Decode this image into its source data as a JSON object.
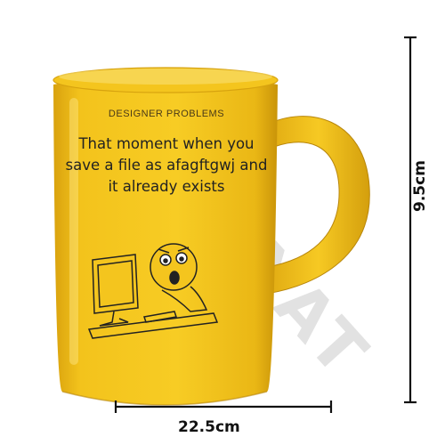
{
  "product": {
    "watermark": "ZEMAYAT",
    "mug": {
      "color": "#f2c21b",
      "label": "DESIGNER PROBLEMS",
      "text_lines": [
        "That moment when you",
        "save a file as afagftgwj and",
        "it already exists"
      ]
    },
    "dimensions": {
      "width": "22.5cm",
      "height": "9.5cm"
    }
  }
}
